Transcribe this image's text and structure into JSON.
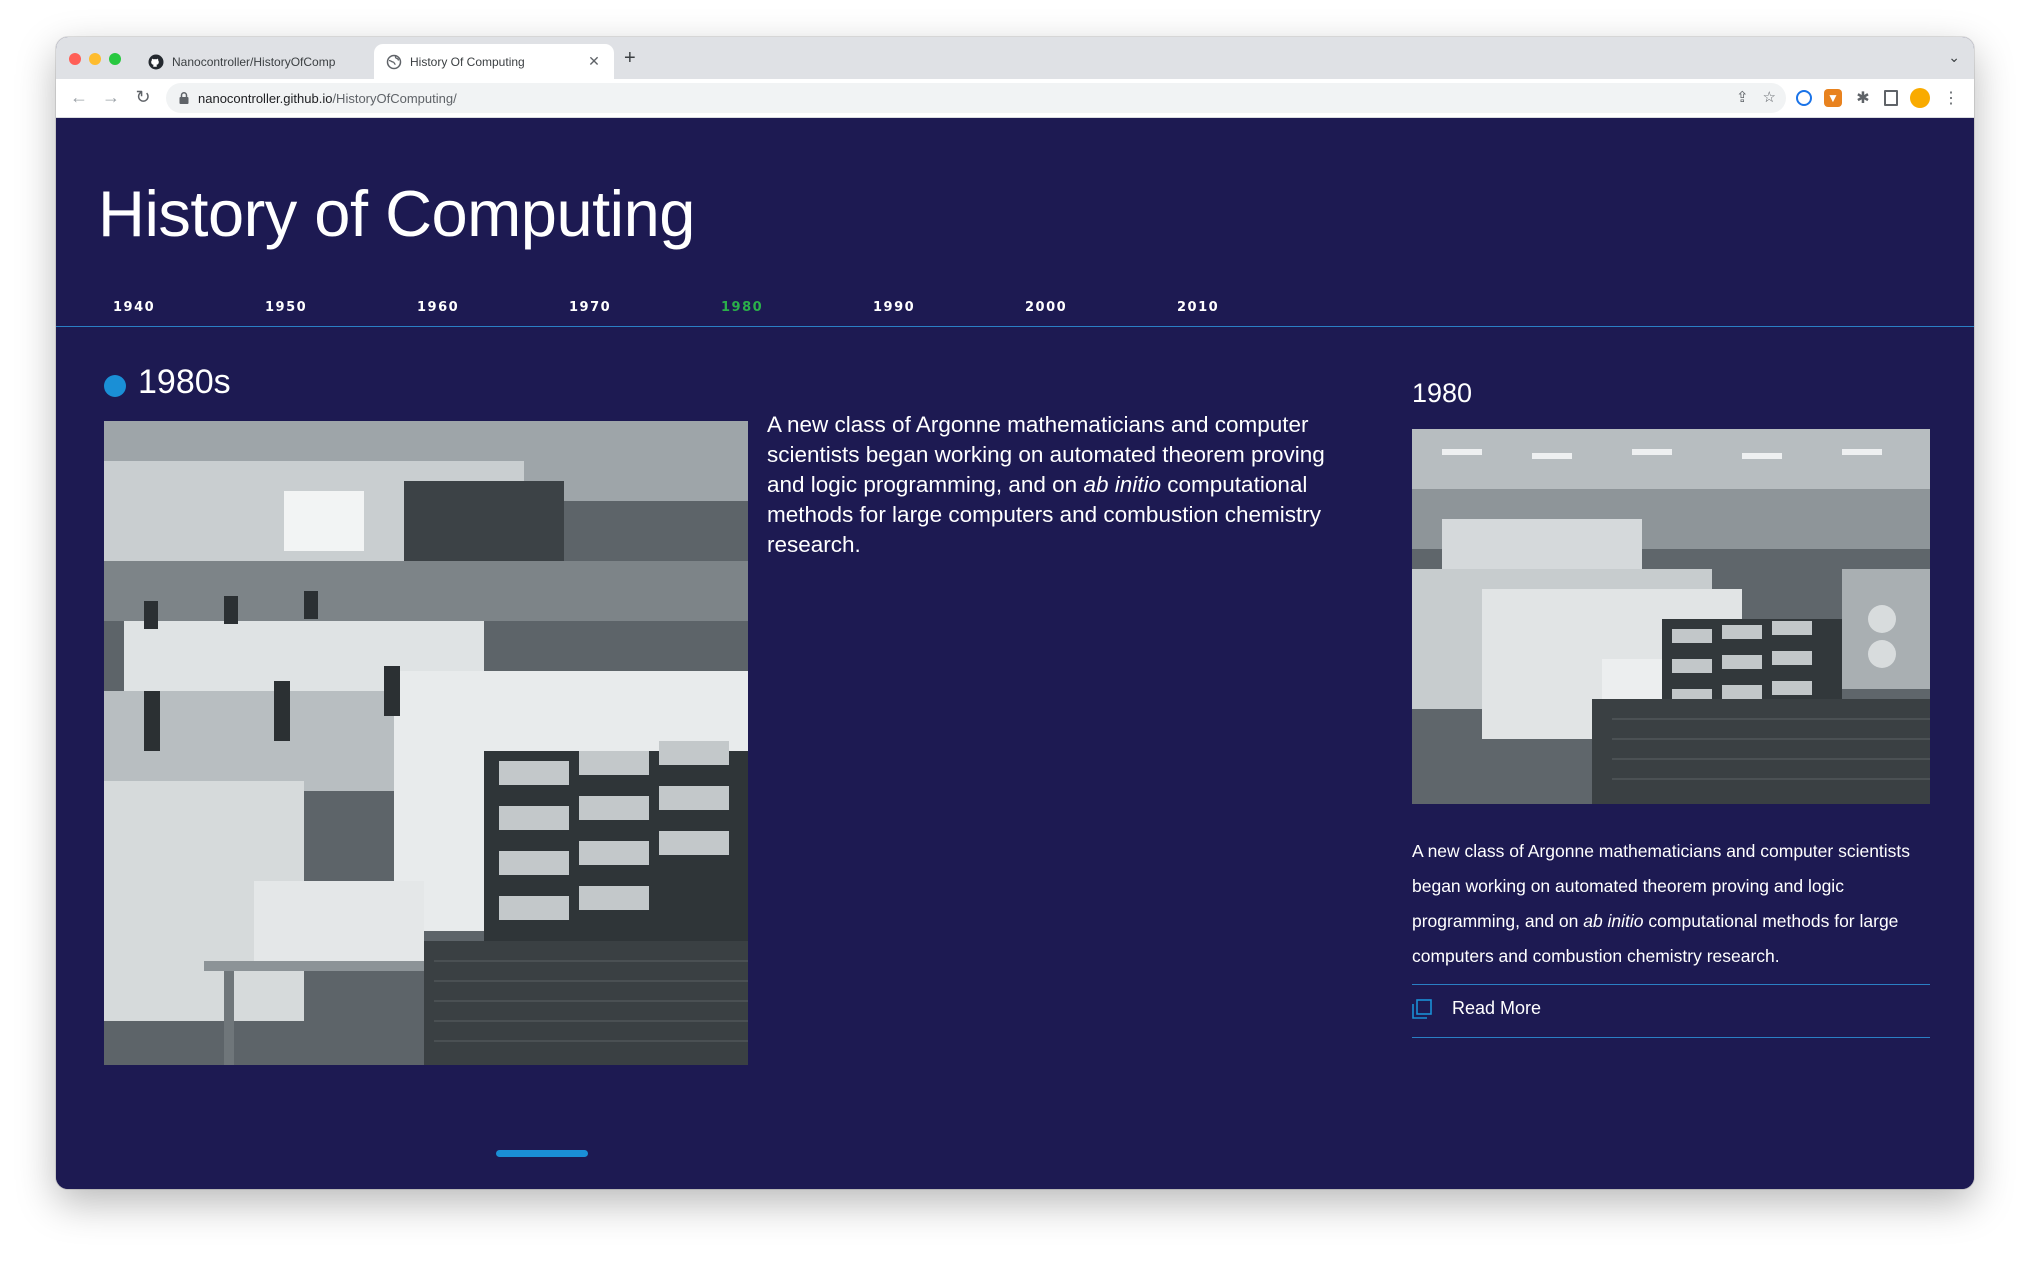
{
  "browser": {
    "tabs": [
      {
        "title": "Nanocontroller/HistoryOfComp",
        "icon": "github-icon",
        "active": false
      },
      {
        "title": "History Of Computing",
        "icon": "globe-icon",
        "active": true
      }
    ],
    "new_tab_label": "+",
    "address": {
      "host": "nanocontroller.github.io",
      "path": "/HistoryOfComputing/"
    }
  },
  "page": {
    "title": "History of Computing",
    "decades": [
      {
        "label": "1940",
        "active": false
      },
      {
        "label": "1950",
        "active": false
      },
      {
        "label": "1960",
        "active": false
      },
      {
        "label": "1970",
        "active": false
      },
      {
        "label": "1980",
        "active": true
      },
      {
        "label": "1990",
        "active": false
      },
      {
        "label": "2000",
        "active": false
      },
      {
        "label": "2010",
        "active": false
      }
    ],
    "era_label": "1980s",
    "lead": {
      "before": "A new class of Argonne mathematicians and computer scientists began working on automated theorem proving and logic programming, and on ",
      "emphasis": "ab initio",
      "after": " computational methods for large computers and combustion chemistry research."
    },
    "side": {
      "year": "1980",
      "text_before": "A new class of Argonne mathematicians and computer scientists began working on automated theorem proving and logic programming, and on ",
      "text_emphasis": "ab initio",
      "text_after": " computational methods for large computers and combustion chemistry research.",
      "read_more_label": "Read More"
    }
  },
  "colors": {
    "page_background": "#1d1a52",
    "accent_blue": "#1a8fd6",
    "active_decade": "#2bb04a",
    "rule": "#2a7fc4"
  }
}
